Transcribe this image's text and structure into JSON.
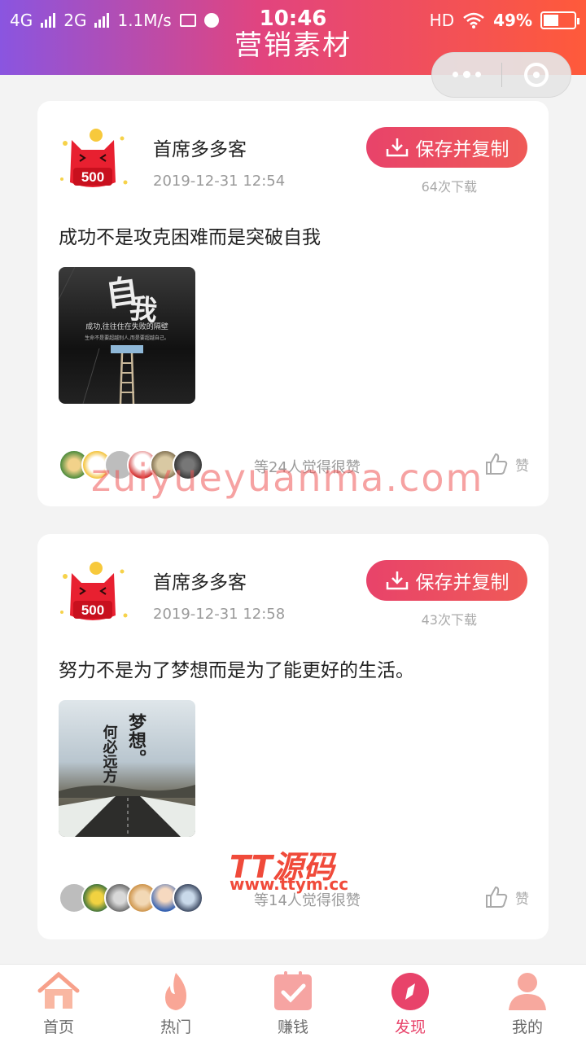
{
  "status_bar": {
    "network1": "4G",
    "network2": "2G",
    "speed": "1.1M/s",
    "time": "10:46",
    "hd": "HD",
    "battery": "49%",
    "battery_level": 0.49
  },
  "header": {
    "title": "营销素材"
  },
  "posts": [
    {
      "author": "首席多多客",
      "avatar_label": "500",
      "date": "2019-12-31 12:54",
      "save_label": "保存并复制",
      "downloads": "64次下载",
      "content": "成功不是攻克困难而是突破自我",
      "like_text": "等24人觉得很赞",
      "like_label": "赞",
      "image_text": [
        "成功,往往住在失败的隔壁",
        "生命不是要超越别人,而是要超越自己。"
      ]
    },
    {
      "author": "首席多多客",
      "avatar_label": "500",
      "date": "2019-12-31 12:58",
      "save_label": "保存并复制",
      "downloads": "43次下载",
      "content": "努力不是为了梦想而是为了能更好的生活。",
      "like_text": "等14人觉得很赞",
      "like_label": "赞",
      "image_text": [
        "何必远方",
        "梦想。"
      ]
    }
  ],
  "tabs": [
    {
      "label": "首页",
      "icon": "home-icon"
    },
    {
      "label": "热门",
      "icon": "flame-icon"
    },
    {
      "label": "赚钱",
      "icon": "check-clipboard-icon"
    },
    {
      "label": "发现",
      "icon": "compass-icon",
      "active": true
    },
    {
      "label": "我的",
      "icon": "user-icon"
    }
  ],
  "watermarks": {
    "site": "zuiyueyuanma.com",
    "brand": "TT源码",
    "url": "www.ttym.cc"
  },
  "colors": {
    "accent": "#e8436a",
    "header_start": "#8a55e0",
    "header_end": "#ff5a3a"
  }
}
